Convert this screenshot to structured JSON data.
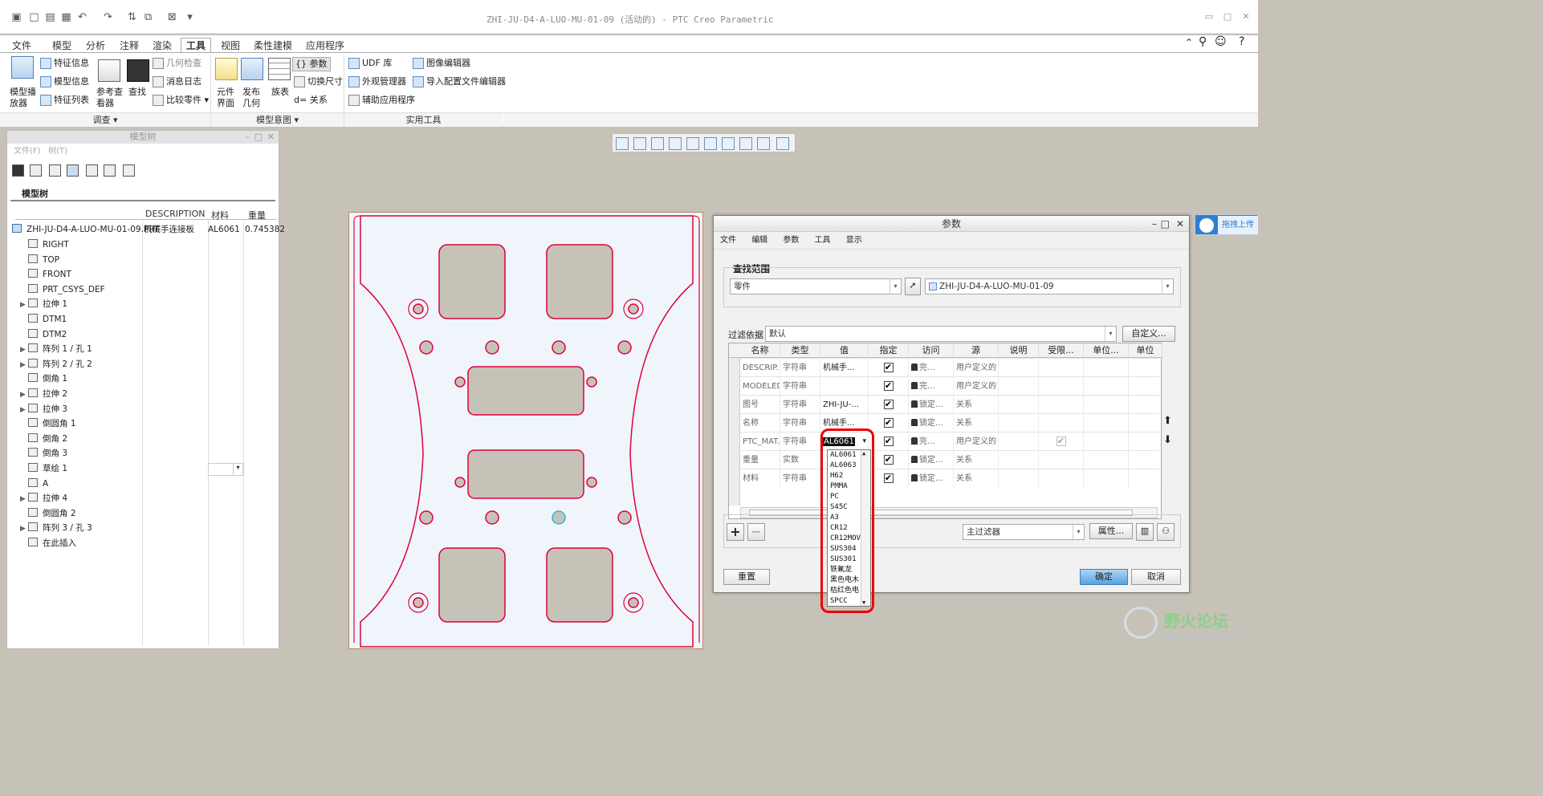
{
  "window": {
    "title": "ZHI-JU-D4-A-LUO-MU-01-09 (活动的) - PTC Creo Parametric"
  },
  "tabs": [
    "文件",
    "模型",
    "分析",
    "注释",
    "渲染",
    "工具",
    "视图",
    "柔性建模",
    "应用程序"
  ],
  "active_tab": "工具",
  "ribbon": {
    "investigate": {
      "model_player": "模型播\n放器",
      "feature_info": "特征信息",
      "model_info": "模型信息",
      "feature_list": "特征列表",
      "ref_viewer": "参考查\n看器",
      "search": "查找",
      "geom_check": "几何检查",
      "msg_log": "消息日志",
      "compare_part": "比较零件",
      "group": "调查"
    },
    "intent": {
      "component_interface": "元件\n界面",
      "publish_geom": "发布\n几何",
      "family_table": "族表",
      "parameters": "参数",
      "switch_dim": "切换尺寸",
      "relations": "d= 关系",
      "group": "模型意图"
    },
    "utilities": {
      "udf": "UDF 库",
      "appearance_mgr": "外观管理器",
      "aux_apps": "辅助应用程序",
      "image_editor": "图像编辑器",
      "import_config": "导入配置文件编辑器",
      "group": "实用工具"
    }
  },
  "model_tree": {
    "panel_title": "模型树",
    "menu": [
      "文件(F)",
      "树(T)"
    ],
    "tree_label": "模型树",
    "columns": [
      "DESCRIPTION",
      "材料",
      "重量"
    ],
    "root": {
      "name": "ZHI-JU-D4-A-LUO-MU-01-09.PRT",
      "description": "机械手连接板",
      "material": "AL6061",
      "weight": "0.745382"
    },
    "items": [
      {
        "name": "RIGHT",
        "expand": ""
      },
      {
        "name": "TOP",
        "expand": ""
      },
      {
        "name": "FRONT",
        "expand": ""
      },
      {
        "name": "PRT_CSYS_DEF",
        "expand": ""
      },
      {
        "name": "拉伸 1",
        "expand": "▶"
      },
      {
        "name": "DTM1",
        "expand": ""
      },
      {
        "name": "DTM2",
        "expand": ""
      },
      {
        "name": "阵列 1 / 孔 1",
        "expand": "▶"
      },
      {
        "name": "阵列 2 / 孔 2",
        "expand": "▶"
      },
      {
        "name": "倒角 1",
        "expand": ""
      },
      {
        "name": "拉伸 2",
        "expand": "▶"
      },
      {
        "name": "拉伸 3",
        "expand": "▶"
      },
      {
        "name": "倒圆角 1",
        "expand": ""
      },
      {
        "name": "倒角 2",
        "expand": ""
      },
      {
        "name": "倒角 3",
        "expand": ""
      },
      {
        "name": "草绘 1",
        "expand": ""
      },
      {
        "name": "A",
        "expand": ""
      },
      {
        "name": "拉伸 4",
        "expand": "▶"
      },
      {
        "name": "倒圆角 2",
        "expand": ""
      },
      {
        "name": "阵列 3 / 孔 3",
        "expand": "▶"
      },
      {
        "name": "在此插入",
        "expand": ""
      }
    ]
  },
  "dialog": {
    "title": "参数",
    "menu": [
      "文件",
      "编辑",
      "参数",
      "工具",
      "显示"
    ],
    "search_scope_label": "查找范围",
    "scope_type": "零件",
    "scope_model": "ZHI-JU-D4-A-LUO-MU-01-09",
    "filter_label": "过滤依据",
    "filter_value": "默认",
    "customize": "自定义...",
    "columns": [
      "名称",
      "类型",
      "值",
      "指定",
      "访问",
      "源",
      "说明",
      "受限...",
      "单位...",
      "单位"
    ],
    "rows": [
      {
        "name": "DESCRIP...",
        "type": "字符串",
        "value": "机械手...",
        "access": "完...",
        "source": "用户定义的"
      },
      {
        "name": "MODELED_BY",
        "type": "字符串",
        "value": "",
        "access": "完...",
        "source": "用户定义的"
      },
      {
        "name": "图号",
        "type": "字符串",
        "value": "ZHI-JU-...",
        "access": "锁定...",
        "source": "关系"
      },
      {
        "name": "名称",
        "type": "字符串",
        "value": "机械手...",
        "access": "锁定...",
        "source": "关系"
      },
      {
        "name": "PTC_MAT...",
        "type": "字符串",
        "value": "AL6061",
        "access": "完...",
        "source": "用户定义的"
      },
      {
        "name": "重量",
        "type": "实数",
        "value": "",
        "access": "锁定...",
        "source": "关系"
      },
      {
        "name": "材料",
        "type": "字符串",
        "value": "",
        "access": "锁定...",
        "source": "关系"
      }
    ],
    "material_options": [
      "AL6061",
      "AL6063",
      "H62",
      "PMMA",
      "PC",
      "S45C",
      "A3",
      "CR12",
      "CR12MOV",
      "SUS304",
      "SUS301",
      "铁氟龙",
      "黑色电木",
      "枯红色电",
      "SPCC"
    ],
    "main_filter": "主过滤器",
    "properties": "属性...",
    "reset": "重置",
    "ok": "确定",
    "cancel": "取消"
  },
  "upload_button": "拖拽上传",
  "watermark": {
    "text": "野火论坛",
    "url": "www.proewildfire.cn"
  }
}
